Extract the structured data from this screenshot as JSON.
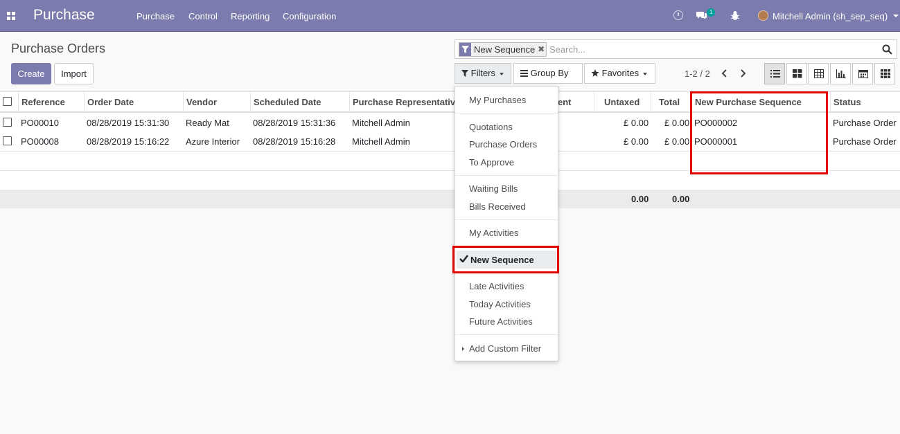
{
  "navbar": {
    "brand": "Purchase",
    "menu": [
      "Purchase",
      "Control",
      "Reporting",
      "Configuration"
    ],
    "chat_badge": "1",
    "user": "Mitchell Admin (sh_sep_seq)"
  },
  "control_panel": {
    "breadcrumb": "Purchase Orders",
    "create_label": "Create",
    "import_label": "Import",
    "search_facet": "New Sequence",
    "search_placeholder": "Search...",
    "filters_label": "Filters",
    "groupby_label": "Group By",
    "favorites_label": "Favorites",
    "pager": "1-2 / 2"
  },
  "table": {
    "columns": [
      "Reference",
      "Order Date",
      "Vendor",
      "Scheduled Date",
      "Purchase Representative",
      "ent",
      "Untaxed",
      "Total",
      "New Purchase Sequence",
      "Status"
    ],
    "rows": [
      {
        "reference": "PO00010",
        "order_date": "08/28/2019 15:31:30",
        "vendor": "Ready Mat",
        "scheduled_date": "08/28/2019 15:31:36",
        "rep": "Mitchell Admin",
        "untaxed": "£ 0.00",
        "total": "£ 0.00",
        "new_seq": "PO000002",
        "status": "Purchase Order"
      },
      {
        "reference": "PO00008",
        "order_date": "08/28/2019 15:16:22",
        "vendor": "Azure Interior",
        "scheduled_date": "08/28/2019 15:16:28",
        "rep": "Mitchell Admin",
        "untaxed": "£ 0.00",
        "total": "£ 0.00",
        "new_seq": "PO000001",
        "status": "Purchase Order"
      }
    ],
    "footer": {
      "untaxed": "0.00",
      "total": "0.00"
    }
  },
  "filters_dropdown": {
    "items": [
      "My Purchases",
      "Quotations",
      "Purchase Orders",
      "To Approve",
      "Waiting Bills",
      "Bills Received",
      "My Activities",
      "New Sequence",
      "Late Activities",
      "Today Activities",
      "Future Activities",
      "Add Custom Filter"
    ],
    "active_item": "New Sequence"
  },
  "colors": {
    "brand": "#7c7bad",
    "highlight": "#e50000",
    "badge": "#00a09d"
  }
}
